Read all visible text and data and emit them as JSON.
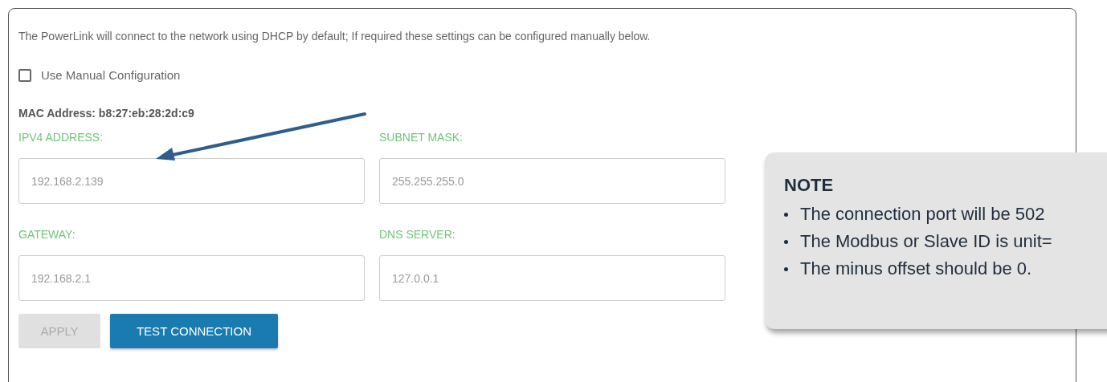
{
  "intro": "The PowerLink will connect to the network using DHCP by default; If required these settings can be configured manually below.",
  "manual_config": {
    "label": "Use Manual Configuration",
    "checked": false
  },
  "mac_address": "MAC Address: b8:27:eb:28:2d:c9",
  "fields": [
    {
      "label": "IPV4 ADDRESS:",
      "value": "192.168.2.139"
    },
    {
      "label": "SUBNET MASK:",
      "value": "255.255.255.0"
    },
    {
      "label": "GATEWAY:",
      "value": "192.168.2.1"
    },
    {
      "label": "DNS SERVER:",
      "value": "127.0.0.1"
    }
  ],
  "buttons": [
    {
      "label": "APPLY",
      "disabled": true
    },
    {
      "label": "TEST CONNECTION",
      "disabled": false
    }
  ],
  "note": {
    "title": "NOTE",
    "items": [
      "The connection port will be 502",
      "The Modbus or Slave ID is unit=",
      "The minus offset should be 0."
    ]
  }
}
